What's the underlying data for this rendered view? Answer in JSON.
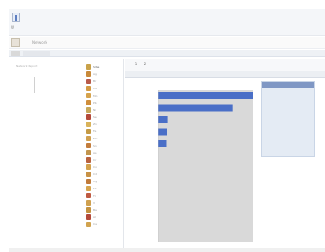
{
  "window": {
    "app_name": "W"
  },
  "toolbar": {
    "label": "Network"
  },
  "left_info": {
    "lines": [
      "Network Report",
      "",
      "",
      "",
      "",
      ""
    ]
  },
  "tree": {
    "items": [
      {
        "label": "Sites",
        "color": "#c9a24a",
        "selected": true
      },
      {
        "label": "Ag",
        "color": "#c98a3a"
      },
      {
        "label": "Br",
        "color": "#b85a4a"
      },
      {
        "label": "Cu",
        "color": "#d39a44"
      },
      {
        "label": "Mo",
        "color": "#d6a34c"
      },
      {
        "label": "Pb",
        "color": "#cf8e3b"
      },
      {
        "label": "Ni",
        "color": "#c7a85a"
      },
      {
        "label": "Se",
        "color": "#b44a3a"
      },
      {
        "label": "Zn",
        "color": "#d9b35a"
      },
      {
        "label": "Fe",
        "color": "#c49a45"
      },
      {
        "label": "Mn",
        "color": "#d0a050"
      },
      {
        "label": "Sn",
        "color": "#c37d3c"
      },
      {
        "label": "As",
        "color": "#c2954d"
      },
      {
        "label": "Cr",
        "color": "#b9623e"
      },
      {
        "label": "Co",
        "color": "#d4a24d"
      },
      {
        "label": "Cd",
        "color": "#c89246"
      },
      {
        "label": "Hg",
        "color": "#c07a3a"
      },
      {
        "label": "Sb",
        "color": "#d6a44e"
      },
      {
        "label": "Ti",
        "color": "#bf5a42"
      },
      {
        "label": "V",
        "color": "#cfa04f"
      },
      {
        "label": "Ba",
        "color": "#c4923f"
      },
      {
        "label": "Al",
        "color": "#b44a3a"
      },
      {
        "label": "Ca",
        "color": "#d1a34e"
      }
    ]
  },
  "right_tabs": [
    "1",
    "2"
  ],
  "chart_data": {
    "type": "bar",
    "orientation": "horizontal",
    "categories": [
      "",
      "",
      "",
      "",
      "",
      "",
      "",
      "",
      "",
      "",
      ""
    ],
    "values": [
      100,
      78,
      10,
      9,
      8,
      0,
      0,
      0,
      0,
      0,
      0
    ],
    "xlim": [
      0,
      100
    ],
    "bar_color": "#4a6fc7",
    "plot_bg": "#d9d9d9",
    "grid": false,
    "title": "",
    "xlabel": "",
    "ylabel": ""
  },
  "legend": {
    "rows": [
      [
        "",
        ""
      ],
      [
        "",
        ""
      ],
      [
        "",
        ""
      ],
      [
        "",
        ""
      ],
      [
        "",
        ""
      ],
      [
        "",
        ""
      ],
      [
        "",
        ""
      ],
      [
        "",
        ""
      ],
      [
        "",
        ""
      ],
      [
        "",
        ""
      ],
      [
        "",
        ""
      ],
      [
        "",
        ""
      ]
    ]
  }
}
